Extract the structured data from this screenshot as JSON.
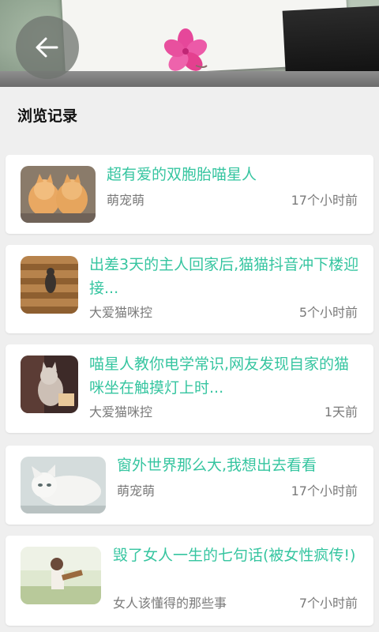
{
  "header": {
    "back_icon": "arrow-left-icon"
  },
  "page": {
    "title": "浏览记录"
  },
  "history": [
    {
      "title": "超有爱的双胞胎喵星人",
      "source": "萌宠萌",
      "time": "17个小时前",
      "thumb": "two-kittens-photo"
    },
    {
      "title": "出差3天的主人回家后,猫猫抖音冲下楼迎接...",
      "source": "大爱猫咪控",
      "time": "5个小时前",
      "thumb": "cat-on-stairs-photo"
    },
    {
      "title": "喵星人教你电学常识,网友发现自家的猫咪坐在触摸灯上时...",
      "source": "大爱猫咪控",
      "time": "1天前",
      "thumb": "cat-lamp-photo"
    },
    {
      "title": "窗外世界那么大,我想出去看看",
      "source": "萌宠萌",
      "time": "17个小时前",
      "thumb": "white-cat-photo"
    },
    {
      "title": "毁了女人一生的七句话(被女性疯传!)",
      "source": "女人该懂得的那些事",
      "time": "7个小时前",
      "thumb": "girl-guitar-photo"
    }
  ],
  "colors": {
    "accent": "#36c5a0",
    "background": "#efefef",
    "meta_text": "#7a7a7a"
  }
}
